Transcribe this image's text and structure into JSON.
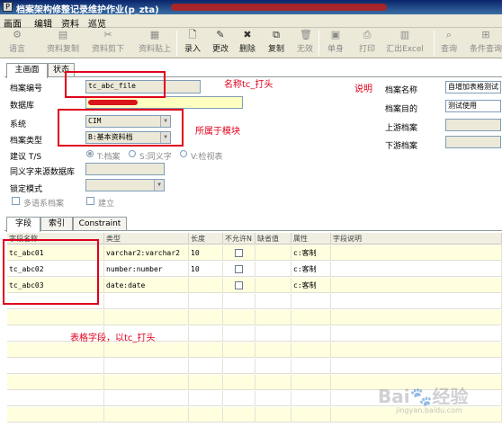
{
  "window": {
    "title": "档案架构修整记录维护作业(p_zta)"
  },
  "menu": [
    "画面",
    "编辑",
    "资料",
    "巡览"
  ],
  "toolbar": [
    {
      "label": "语言",
      "icon": "language-icon",
      "glyph": "⚙",
      "enabled": false
    },
    {
      "label": "资料复制",
      "icon": "copy-data-icon",
      "glyph": "▤",
      "enabled": false
    },
    {
      "label": "资料剪下",
      "icon": "cut-data-icon",
      "glyph": "✂",
      "enabled": false
    },
    {
      "label": "资料贴上",
      "icon": "paste-data-icon",
      "glyph": "▦",
      "enabled": false
    },
    {
      "label": "录入",
      "icon": "new-record-icon",
      "glyph": "🗋",
      "enabled": true
    },
    {
      "label": "更改",
      "icon": "edit-icon",
      "glyph": "✎",
      "enabled": true
    },
    {
      "label": "删除",
      "icon": "delete-icon",
      "glyph": "✖",
      "enabled": true
    },
    {
      "label": "复制",
      "icon": "copy-icon",
      "glyph": "⧉",
      "enabled": true
    },
    {
      "label": "无效",
      "icon": "invalid-icon",
      "glyph": "🗑",
      "enabled": false
    },
    {
      "label": "单身",
      "icon": "detail-icon",
      "glyph": "▣",
      "enabled": false
    },
    {
      "label": "打印",
      "icon": "print-icon",
      "glyph": "⎙",
      "enabled": false
    },
    {
      "label": "汇出Excel",
      "icon": "excel-export-icon",
      "glyph": "▥",
      "enabled": false
    },
    {
      "label": "查询",
      "icon": "query-icon",
      "glyph": "⌕",
      "enabled": false
    },
    {
      "label": "条件查询",
      "icon": "condition-query-icon",
      "glyph": "⊞",
      "enabled": false
    }
  ],
  "main_tabs": [
    "主画面",
    "状态"
  ],
  "form": {
    "archive_code_label": "档案编号",
    "archive_code_value": "tc_abc_file",
    "database_label": "数据库",
    "system_label": "系统",
    "system_value": "CIM",
    "archive_type_label": "档案类型",
    "archive_type_value": "B:基本资料档",
    "build_label": "建议 T/S",
    "radio_t": "T:档案",
    "radio_s": "S:同义字",
    "radio_v": "V:检视表",
    "synonym_db_label": "同义字来源数据库",
    "lock_mode_label": "锁定模式",
    "multilang_label": "多语系档案",
    "create_label": "建立",
    "archive_name_label": "档案名称",
    "archive_name_value": "自增加表格测试",
    "archive_purpose_label": "档案目的",
    "archive_purpose_value": "测试使用",
    "upstream_label": "上游档案",
    "downstream_label": "下游档案"
  },
  "annotations": {
    "name_note": "名称tc_打头",
    "explain_note": "说明",
    "module_note": "所属于模块",
    "fields_note": "表格字段，以tc_打头"
  },
  "detail_tabs": [
    "字段",
    "索引",
    "Constraint"
  ],
  "grid": {
    "headers": [
      "字段名称",
      "类型",
      "长度",
      "不允许N",
      "缺省值",
      "属性",
      "字段说明"
    ],
    "rows": [
      {
        "name": "tc_abc01",
        "type": "varchar2:varchar2",
        "length": "10",
        "notnull": false,
        "default": "",
        "attr": "c:客制",
        "desc": ""
      },
      {
        "name": "tc_abc02",
        "type": "number:number",
        "length": "10",
        "notnull": false,
        "default": "",
        "attr": "c:客制",
        "desc": ""
      },
      {
        "name": "tc_abc03",
        "type": "date:date",
        "length": "",
        "notnull": false,
        "default": "",
        "attr": "c:客制",
        "desc": ""
      }
    ]
  },
  "watermark": {
    "logo": "Baidu经验",
    "url": "jingyan.baidu.com"
  }
}
